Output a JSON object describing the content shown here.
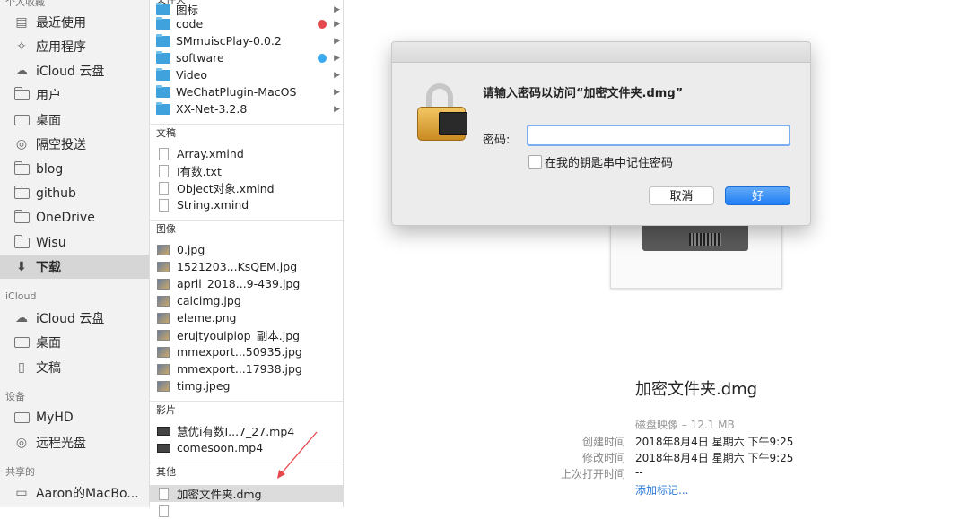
{
  "sidebar": {
    "section_favorites": "个人收藏",
    "favorites": [
      {
        "label": "最近使用",
        "icon": "recents-icon"
      },
      {
        "label": "应用程序",
        "icon": "applications-icon"
      },
      {
        "label": "iCloud 云盘",
        "icon": "cloud-icon"
      },
      {
        "label": "用户",
        "icon": "folder-icon"
      },
      {
        "label": "桌面",
        "icon": "desktop-icon"
      },
      {
        "label": "隔空投送",
        "icon": "airdrop-icon"
      },
      {
        "label": "blog",
        "icon": "folder-icon"
      },
      {
        "label": "github",
        "icon": "folder-icon"
      },
      {
        "label": "OneDrive",
        "icon": "folder-icon"
      },
      {
        "label": "Wisu",
        "icon": "folder-icon"
      },
      {
        "label": "下载",
        "icon": "downloads-icon",
        "selected": true
      }
    ],
    "section_icloud": "iCloud",
    "icloud": [
      {
        "label": "iCloud 云盘",
        "icon": "cloud-icon"
      },
      {
        "label": "桌面",
        "icon": "desktop-icon"
      },
      {
        "label": "文稿",
        "icon": "documents-icon"
      }
    ],
    "section_devices": "设备",
    "devices": [
      {
        "label": "MyHD",
        "icon": "hard-disk-icon"
      },
      {
        "label": "远程光盘",
        "icon": "disc-icon"
      }
    ],
    "section_shared": "共享的",
    "shared": [
      {
        "label": "Aaron的MacBo...",
        "icon": "computer-icon"
      }
    ]
  },
  "column": {
    "group_folders": "文件夹",
    "folders": [
      {
        "name": "图标",
        "tag": ""
      },
      {
        "name": "code",
        "tag": "#e5484d"
      },
      {
        "name": "SMmuiscPlay-0.0.2",
        "tag": ""
      },
      {
        "name": "software",
        "tag": "#3aa9f0"
      },
      {
        "name": "Video",
        "tag": ""
      },
      {
        "name": "WeChatPlugin-MacOS",
        "tag": ""
      },
      {
        "name": "XX-Net-3.2.8",
        "tag": ""
      }
    ],
    "group_docs": "文稿",
    "docs": [
      "Array.xmind",
      "I有数.txt",
      "Object对象.xmind",
      "String.xmind"
    ],
    "group_images": "图像",
    "images": [
      "0.jpg",
      "1521203...KsQEM.jpg",
      "april_2018...9-439.jpg",
      "calcimg.jpg",
      "eleme.png",
      "erujtyouipiop_副本.jpg",
      "mmexport...50935.jpg",
      "mmexport...17938.jpg",
      "timg.jpeg"
    ],
    "group_movies": "影片",
    "movies": [
      "慧优i有数I...7_27.mp4",
      "comesoon.mp4"
    ],
    "group_other": "其他",
    "other": [
      "加密文件夹.dmg"
    ]
  },
  "preview": {
    "filename": "加密文件夹.dmg",
    "kind": "磁盘映像 – 12.1 MB",
    "meta": [
      {
        "label": "创建时间",
        "value": "2018年8月4日 星期六 下午9:25"
      },
      {
        "label": "修改时间",
        "value": "2018年8月4日 星期六 下午9:25"
      },
      {
        "label": "上次打开时间",
        "value": "--"
      }
    ],
    "add_tags": "添加标记..."
  },
  "dialog": {
    "message": "请输入密码以访问“加密文件夹.dmg”",
    "password_label": "密码:",
    "password_value": "",
    "remember_label": "在我的钥匙串中记住密码",
    "remember_checked": false,
    "cancel_label": "取消",
    "ok_label": "好"
  },
  "colors": {
    "accent": "#1f7ef3",
    "tag_red": "#e5484d",
    "tag_blue": "#3aa9f0"
  }
}
